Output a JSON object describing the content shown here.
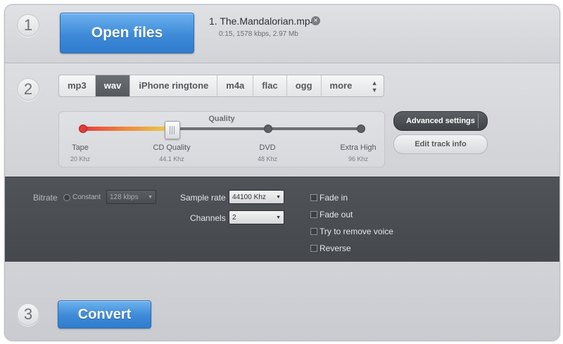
{
  "steps": {
    "one": "1",
    "two": "2",
    "three": "3"
  },
  "open_files": {
    "label": "Open files"
  },
  "file": {
    "name": "1. The.Mandalorian.mp4",
    "meta": "0:15, 1578 kbps, 2.97 Mb",
    "remove_icon": "×"
  },
  "formats": {
    "items": [
      "mp3",
      "wav",
      "iPhone ringtone",
      "m4a",
      "flac",
      "ogg",
      "more"
    ],
    "selected": "wav",
    "more_arrows": "▲▼"
  },
  "quality": {
    "title": "Quality",
    "selected_level": 0.25,
    "levels": [
      {
        "label": "Tape",
        "sub": "20 Khz"
      },
      {
        "label": "CD Quality",
        "sub": "44.1 Khz"
      },
      {
        "label": "DVD",
        "sub": "48 Khz"
      },
      {
        "label": "Extra High",
        "sub": "96 Khz"
      }
    ]
  },
  "advanced_settings": {
    "label": "Advanced settings"
  },
  "edit_track_info": {
    "label": "Edit track info"
  },
  "advanced": {
    "bitrate_label": "Bitrate",
    "constant_label": "Constant",
    "bitrate_value": "128 kbps",
    "sample_rate_label": "Sample rate",
    "sample_rate_value": "44100 Khz",
    "channels_label": "Channels",
    "channels_value": "2",
    "checkboxes": [
      "Fade in",
      "Fade out",
      "Try to remove voice",
      "Reverse"
    ],
    "caret": "▼"
  },
  "convert": {
    "label": "Convert"
  },
  "colors": {
    "accent": "#3e8ad8",
    "panel_dark": "#4a4d52",
    "background": "#d6d8dc"
  }
}
